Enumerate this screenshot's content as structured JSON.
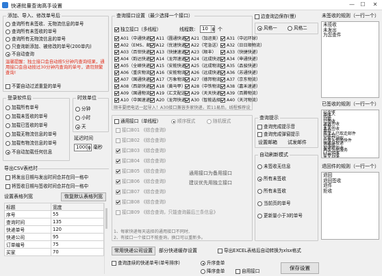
{
  "window": {
    "title": "快递批量查询高手设置",
    "min": "—",
    "max": "☐",
    "close": "✕"
  },
  "add_group": {
    "title": "添加、导入、修改单号后",
    "options": [
      {
        "label": "查询所有未签收、无物流信息的单号",
        "checked": false
      },
      {
        "label": "查询所有未签收的单号",
        "checked": false
      },
      {
        "label": "查询所有无物流信息的单号",
        "checked": false
      },
      {
        "label": "只查询新添加、被修改的单号(200单内)",
        "checked": false
      },
      {
        "label": "不自动查询",
        "checked": true
      }
    ],
    "warning": [
      "温馨提醒：独立接口会自动按5分钟内查询结果，通用接口会自动按过30分钟内查询的单号，请勿频繁查询!"
    ],
    "no_auto_query": {
      "label": "不要自动过滤重复的单号",
      "checked": false
    }
  },
  "after_login": {
    "title": "登录软件后",
    "options": [
      {
        "label": "加载所有单号",
        "checked": false
      },
      {
        "label": "加载未签收的单号",
        "checked": false
      },
      {
        "label": "加载已签收的单号",
        "checked": false
      },
      {
        "label": "加载无物流信息的单号",
        "checked": false
      },
      {
        "label": "加载有物流信息的单号",
        "checked": false
      },
      {
        "label": "不自动加载任何信息",
        "checked": true
      }
    ]
  },
  "time_unit": {
    "title": "时效单位",
    "options": [
      {
        "label": "分钟",
        "checked": false
      },
      {
        "label": "小时",
        "checked": false
      },
      {
        "label": "天",
        "checked": true
      }
    ],
    "delay_label": "延迟时间",
    "delay_value": "1000",
    "delay_unit": "毫秒"
  },
  "export_csv": {
    "title": "导出CSV表格时",
    "options": [
      {
        "label": "将发出日期与发出时间合并在同一格中",
        "checked": false
      },
      {
        "label": "将签收日期与签收时间合并在同一格中",
        "checked": false
      }
    ]
  },
  "table_settings": {
    "title": "设置表格列宽",
    "reset_button": "恢复默认表格列宽",
    "headers": [
      "标题",
      "宽度"
    ],
    "rows": [
      [
        "序号",
        "55"
      ],
      [
        "查询时间",
        "135"
      ],
      [
        "快递单号",
        "120"
      ],
      [
        "快递公司",
        "95"
      ],
      [
        "订单编号",
        "75"
      ],
      [
        "买家",
        "70"
      ]
    ]
  },
  "interface": {
    "title": "查询接口设置（最少选择一个接口）",
    "independent": {
      "label": "独立接口（多线程）",
      "checked": true
    },
    "threads_label": "线程数:",
    "threads_value": "10",
    "threads_unit": "个",
    "columns": [
      [
        {
          "label": "A01（中通快递）",
          "checked": true
        },
        {
          "label": "A02（EMS、邮政）",
          "checked": true
        },
        {
          "label": "A03（百世快递）",
          "checked": true
        },
        {
          "label": "A04（韵达快递）",
          "checked": true
        },
        {
          "label": "A05（全峰快递）",
          "checked": true
        },
        {
          "label": "A06（重庆物流）",
          "checked": true
        },
        {
          "label": "A07（国通快递）",
          "checked": true
        },
        {
          "label": "A08（西部快递）",
          "checked": true
        },
        {
          "label": "A09（国通物流）",
          "checked": true
        },
        {
          "label": "A10（中国速递）",
          "checked": true
        }
      ],
      [
        {
          "label": "A11（圆通快递）",
          "checked": true
        },
        {
          "label": "A12（优速快递）",
          "checked": true
        },
        {
          "label": "A13（快捷速递）",
          "checked": true
        },
        {
          "label": "A14（龙邦速递）",
          "checked": true
        },
        {
          "label": "A15（安能快递）",
          "checked": true
        },
        {
          "label": "A16（安能物流）",
          "checked": true
        },
        {
          "label": "A17（万象物流）",
          "checked": true
        },
        {
          "label": "A18（黄马甲）",
          "checked": true
        },
        {
          "label": "A19（汇文配送）",
          "checked": true
        },
        {
          "label": "A20（龙邦快递）",
          "checked": true
        }
      ],
      [
        {
          "label": "A21（加运美）",
          "checked": true
        },
        {
          "label": "A22（宅急送）",
          "checked": true
        },
        {
          "label": "A23（顺丰）",
          "checked": true
        },
        {
          "label": "A24（远成快运）",
          "checked": true
        },
        {
          "label": "A25（远成物流）",
          "checked": true
        },
        {
          "label": "A26（远成快递）",
          "checked": true
        },
        {
          "label": "A27（德邦物流）",
          "checked": true
        },
        {
          "label": "A28（中铁物流）",
          "checked": true
        },
        {
          "label": "A29（天天快递）",
          "checked": true
        },
        {
          "label": "A30（智能选择）",
          "checked": true
        }
      ],
      [
        {
          "label": "A31（中远环球）",
          "checked": true
        },
        {
          "label": "A32（日日顺物流）",
          "checked": true
        },
        {
          "label": "A33（快捷快递）",
          "checked": true
        },
        {
          "label": "A34（申通快递）",
          "checked": true
        },
        {
          "label": "A35（品骏快递）",
          "checked": true
        },
        {
          "label": "A36（苏通快递）",
          "checked": true
        },
        {
          "label": "A37（京东物流）",
          "checked": true
        },
        {
          "label": "A38（嘉禾速递）",
          "checked": true
        },
        {
          "label": "A39（百腾物流）",
          "checked": true
        },
        {
          "label": "A40（天河物流）",
          "checked": true
        }
      ]
    ],
    "note": "顺丰要把电话一起导入！A30接口兼容多家快递，若11易后，线程推荐设置5个以内。"
  },
  "generic": {
    "label": "通用接口（单线程）",
    "checked": false,
    "modes": [
      {
        "label": "顺序模式",
        "checked": true
      },
      {
        "label": "随机模式",
        "checked": false
      }
    ],
    "items": [
      "接口B01  《综合查询》",
      "接口B02  《综合查询》",
      "接口B03  《综合查询》",
      "接口B04  《综合查询》",
      "接口B05  《综合查询》",
      "接口B06  《综合查询》",
      "接口B07  《综合查询》",
      "接口B08  《综合查询》",
      "接口B09  《综合查询，只能查询最后三条信息》"
    ],
    "hint1": "通用接口为备用接口",
    "hint2": "建议优先用独立接口",
    "footnote1": "1、每家快递每天选择的通用接口不同时,",
    "footnote2": "2、有接口一个接口不能查询，换口可以重新多。"
  },
  "border_sign": {
    "label": "边查询边保存(慢)",
    "checked": false
  },
  "style": {
    "options": [
      {
        "label": "风格一",
        "checked": true
      },
      {
        "label": "风格二",
        "checked": false
      }
    ]
  },
  "query_prompt": {
    "title": "查询提示",
    "options": [
      {
        "label": "查询完成提示音",
        "checked": false
      },
      {
        "label": "查询完成弹窗提示",
        "checked": false
      }
    ],
    "mail_settings": "设置邮箱",
    "mail_test": "试发邮件"
  },
  "auto_refresh": {
    "title": "自动刷新模式",
    "options": [
      {
        "label": "未签收无信息",
        "checked": false
      },
      {
        "label": "所有未签收",
        "checked": true
      },
      {
        "label": "所有未签收",
        "checked": false
      },
      {
        "label": "当前页的单号",
        "checked": false
      },
      {
        "label": "更新量小于3的单号",
        "checked": false
      }
    ]
  },
  "bottom": {
    "common_button": "常用快递公司设置",
    "partial_button": "部分快递缓存设置",
    "excel_export": {
      "label": "导出EXCEL表格后自动转换为xlsx格式",
      "checked": false
    },
    "continuous": {
      "label": "查询连续的快递单号(单号排序)",
      "checked": false
    },
    "sort_asc": {
      "label": "升序查单",
      "checked": true
    },
    "sort_desc": {
      "label": "降序查单",
      "checked": false
    },
    "auto_use": {
      "label": "自用接口",
      "checked": false
    },
    "save_button": "保存设置"
  },
  "unsigned_rules": {
    "title": "未签收的规则（一行一个）",
    "lines": [
      "未揽收",
      "未发出",
      "为您查件"
    ]
  },
  "signed_rules": {
    "title": "已签收的规则（一行一个）",
    "lines": [
      "已签收",
      "签收人",
      "代收",
      "已取",
      "已签收",
      "派送签收",
      "妥投",
      "本人签收",
      "自提",
      "签字人已取走邮件",
      "已收到",
      "买家已领取",
      "已放入您的快件",
      "快递员投递",
      "已完成",
      "投递并签收",
      "再次为您服务",
      "门卫代收",
      "前台代收",
      "本人已收"
    ]
  },
  "returned_rules": {
    "title": "退回件的规则（一行一个）",
    "lines": [
      "退回",
      "退回签收",
      "退件",
      "拒收"
    ]
  }
}
